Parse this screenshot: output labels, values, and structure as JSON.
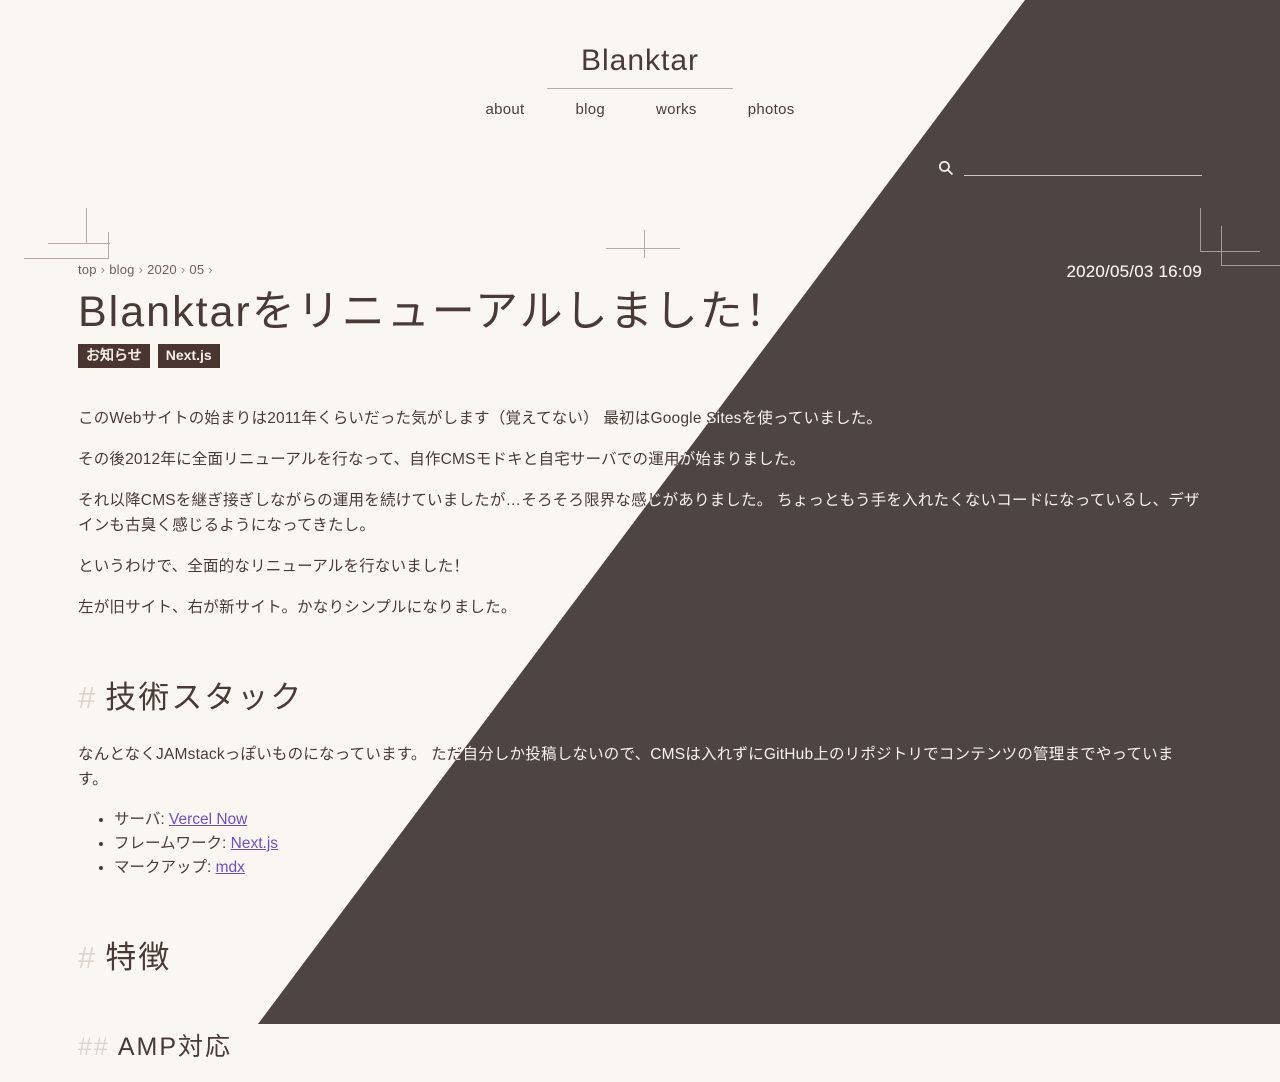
{
  "site": {
    "title": "Blanktar",
    "nav": [
      {
        "label": "about"
      },
      {
        "label": "blog"
      },
      {
        "label": "works"
      },
      {
        "label": "photos"
      }
    ]
  },
  "search": {
    "icon": "search-icon",
    "value": "",
    "placeholder": ""
  },
  "article": {
    "breadcrumb": [
      {
        "label": "top"
      },
      {
        "label": "blog"
      },
      {
        "label": "2020"
      },
      {
        "label": "05"
      }
    ],
    "breadcrumb_separator": "›",
    "date": "2020/05/03 16:09",
    "title": "Blanktarをリニューアルしました！",
    "tags": [
      {
        "label": "お知らせ"
      },
      {
        "label": "Next.js"
      }
    ],
    "paragraphs": [
      "このWebサイトの始まりは2011年くらいだった気がします（覚えてない） 最初はGoogle Sitesを使っていました。",
      "その後2012年に全面リニューアルを行なって、自作CMSモドキと自宅サーバでの運用が始まりました。",
      "それ以降CMSを継ぎ接ぎしながらの運用を続けていましたが…そろそろ限界な感じがありました。 ちょっともう手を入れたくないコードになっているし、デザインも古臭く感じるようになってきたし。",
      "というわけで、全面的なリニューアルを行ないました！",
      "左が旧サイト、右が新サイト。かなりシンプルになりました。"
    ],
    "section_tech": {
      "hash": "#",
      "heading": "技術スタック",
      "paragraph": "なんとなくJAMstackっぽいものになっています。 ただ自分しか投稿しないので、CMSは入れずにGitHub上のリポジトリでコンテンツの管理までやっています。",
      "items": [
        {
          "label": "サーバ: ",
          "link": "Vercel Now"
        },
        {
          "label": "フレームワーク: ",
          "link": "Next.js"
        },
        {
          "label": "マークアップ: ",
          "link": "mdx"
        }
      ]
    },
    "section_features": {
      "hash": "#",
      "heading": "特徴",
      "sub_hash": "##",
      "sub_heading": "AMP対応"
    }
  },
  "colors": {
    "background": "#faf7f2",
    "dark_panel": "#4e4441",
    "text": "#4a3a35",
    "text_inverted": "#f7f3ee",
    "tag_bg": "#4a3530",
    "link": "#6c4fc0"
  }
}
